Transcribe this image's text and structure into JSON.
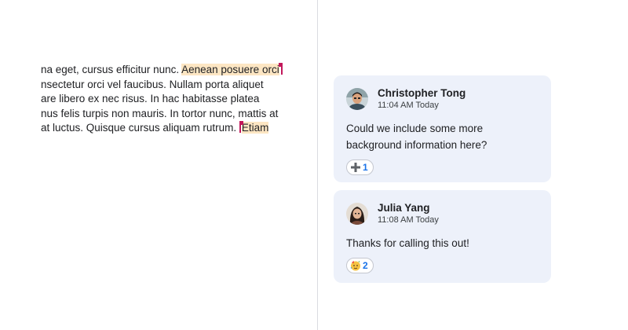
{
  "document": {
    "lines": [
      {
        "pre": "na eget, cursus efficitur nunc. ",
        "hl": "Aenean posuere orci"
      },
      {
        "pre": "nsectetur orci vel faucibus. Nullam porta aliquet",
        "hl": ""
      },
      {
        "pre": "are libero ex nec risus. In hac habitasse platea",
        "hl": ""
      },
      {
        "pre": "nus felis turpis non mauris. In tortor nunc, mattis at",
        "hl": ""
      },
      {
        "pre": "at luctus. Quisque cursus aliquam rutrum. ",
        "hl": "Etiam"
      }
    ]
  },
  "comments": [
    {
      "author": "Christopher Tong",
      "time": "11:04 AM Today",
      "text": "Could we include some more background information here?",
      "reaction": {
        "icon": "plus-icon",
        "emoji": "➕",
        "count": "1"
      }
    },
    {
      "author": "Julia Yang",
      "time": "11:08 AM Today",
      "text": "Thanks for calling this out!",
      "reaction": {
        "icon": "party-face-icon",
        "emoji": "🥳",
        "count": "2"
      }
    }
  ],
  "colors": {
    "highlight": "#fde6c3",
    "card_bg": "#edf1fa",
    "cursor": "#c2185b",
    "reaction_count": "#1a73e8"
  }
}
